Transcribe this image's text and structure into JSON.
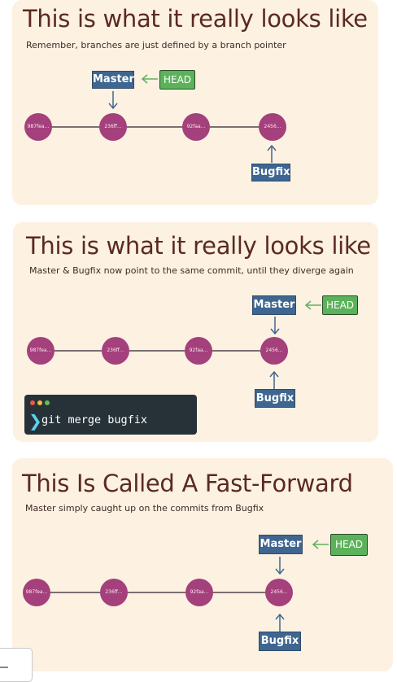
{
  "colors": {
    "slide_bg": "#fdf1e1",
    "title": "#5a2a22",
    "commit": "#a4407c",
    "branch_tag": "#3f6690",
    "head_tag": "#5cb25a",
    "arrow_green": "#5cb25a",
    "arrow_blue": "#3f6690",
    "terminal_bg": "#263238"
  },
  "slides": [
    {
      "title": "This is what it really looks like",
      "subtitle": "Remember, branches are just defined by a branch pointer",
      "commits": [
        "987fea...",
        "236ff...",
        "92faa...",
        "2456..."
      ],
      "master_label": "Master",
      "head_label": "HEAD",
      "bugfix_label": "Bugfix"
    },
    {
      "title": "This is what it really looks like",
      "subtitle": "Master & Bugfix now point to the same commit, until they diverge again",
      "commits": [
        "987fea...",
        "236ff...",
        "92faa...",
        "2456..."
      ],
      "master_label": "Master",
      "head_label": "HEAD",
      "bugfix_label": "Bugfix",
      "terminal": {
        "prompt_icon": "chevron-right-icon",
        "command": "git merge bugfix"
      }
    },
    {
      "title": "This Is Called A Fast-Forward",
      "subtitle": "Master simply caught up on the commits from Bugfix",
      "commits": [
        "987fea...",
        "236ff...",
        "92faa...",
        "2456..."
      ],
      "master_label": "Master",
      "head_label": "HEAD",
      "bugfix_label": "Bugfix"
    }
  ]
}
